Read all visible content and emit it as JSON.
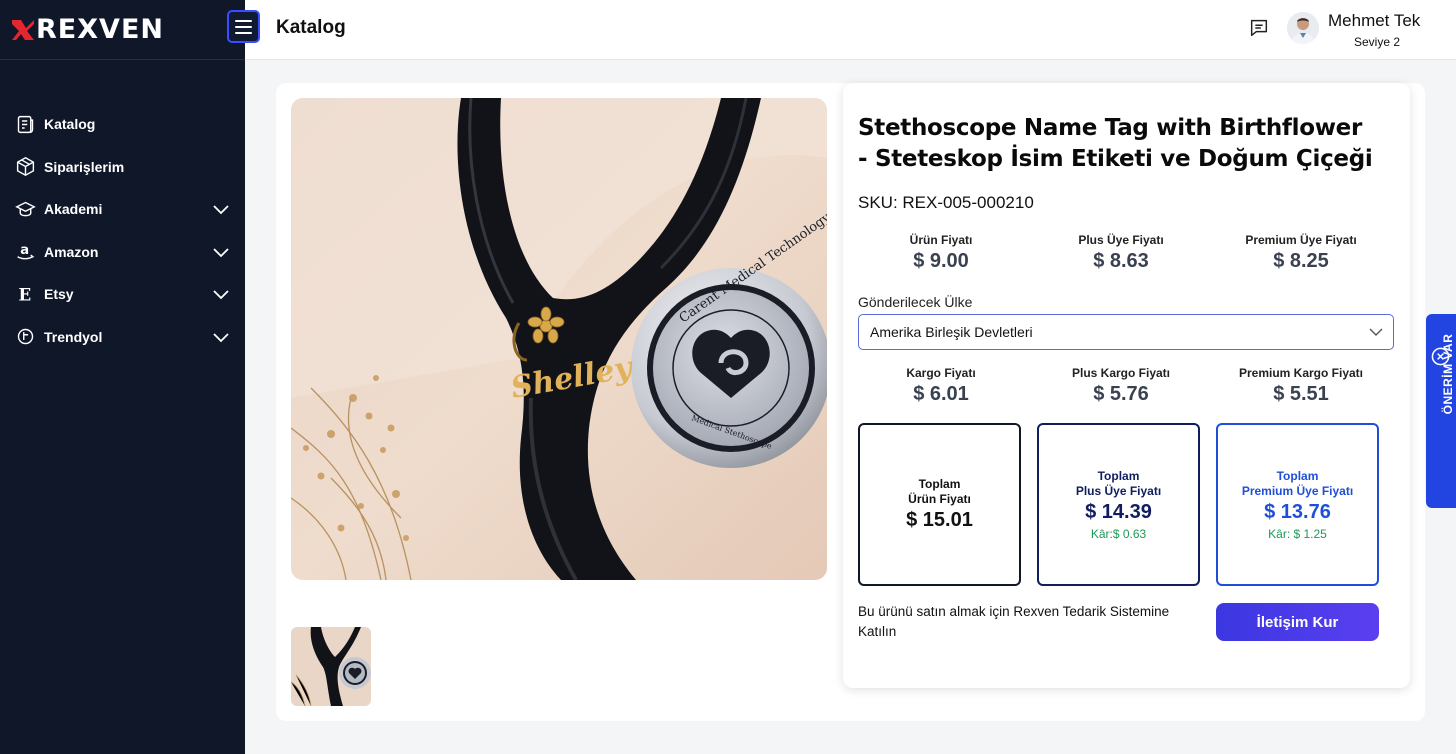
{
  "brand": {
    "name": "REXVEN"
  },
  "header": {
    "page_title": "Katalog",
    "user": {
      "name": "Mehmet Tek",
      "level": "Seviye 2"
    }
  },
  "sidebar": {
    "items": [
      {
        "label": "Katalog",
        "icon": "catalog-icon",
        "expandable": false
      },
      {
        "label": "Siparişlerim",
        "icon": "box-icon",
        "expandable": false
      },
      {
        "label": "Akademi",
        "icon": "graduation-cap-icon",
        "expandable": true
      },
      {
        "label": "Amazon",
        "icon": "amazon-icon",
        "expandable": true
      },
      {
        "label": "Etsy",
        "icon": "etsy-icon",
        "expandable": true
      },
      {
        "label": "Trendyol",
        "icon": "trendyol-icon",
        "expandable": true
      }
    ]
  },
  "product": {
    "title": "Stethoscope Name Tag with Birthflower - Steteskop İsim Etiketi ve Doğum Çiçeği",
    "sku": "SKU: REX-005-000210",
    "image_text": {
      "ring": "Carent Medical Technology",
      "bottom": "Medical Stethoscope",
      "tag": "Shelley"
    },
    "prices": [
      {
        "label": "Ürün Fiyatı",
        "value": "$ 9.00"
      },
      {
        "label": "Plus Üye Fiyatı",
        "value": "$ 8.63"
      },
      {
        "label": "Premium Üye Fiyatı",
        "value": "$ 8.25"
      }
    ],
    "country": {
      "label": "Gönderilecek Ülke",
      "selected": "Amerika Birleşik Devletleri"
    },
    "shipping": [
      {
        "label": "Kargo Fiyatı",
        "value": "$ 6.01"
      },
      {
        "label": "Plus Kargo Fiyatı",
        "value": "$ 5.76"
      },
      {
        "label": "Premium Kargo Fiyatı",
        "value": "$ 5.51"
      }
    ],
    "totals": [
      {
        "label_line1": "Toplam",
        "label_line2": "Ürün Fiyatı",
        "value": "$ 15.01",
        "profit": ""
      },
      {
        "label_line1": "Toplam",
        "label_line2": "Plus Üye Fiyatı",
        "value": "$ 14.39",
        "profit": "Kâr:$ 0.63"
      },
      {
        "label_line1": "Toplam",
        "label_line2": "Premium Üye Fiyatı",
        "value": "$ 13.76",
        "profit": "Kâr: $ 1.25"
      }
    ],
    "join_text": "Bu ürünü satın almak için Rexven Tedarik Sistemine Katılın",
    "contact_button": "İletişim Kur"
  },
  "suggestion_tab": {
    "label": "ÖNERİM VAR"
  },
  "colors": {
    "sidebar_bg": "#0f1729",
    "brand_red": "#e3262f",
    "plus_navy": "#101d5e",
    "premium_blue": "#1f4fd6",
    "profit_green": "#1b9a55",
    "accent": "#3b37e0"
  }
}
